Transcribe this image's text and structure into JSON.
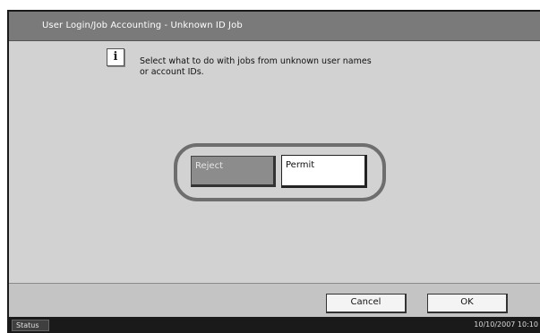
{
  "header": {
    "title": "User Login/Job Accounting - Unknown ID Job"
  },
  "message": {
    "icon": "info-icon",
    "text": "Select what to do with jobs from unknown user names\nor account IDs."
  },
  "options": {
    "reject_label": "Reject",
    "permit_label": "Permit",
    "selected": "Reject"
  },
  "footer": {
    "cancel_label": "Cancel",
    "ok_label": "OK"
  },
  "statusbar": {
    "status_label": "Status",
    "datetime": "10/10/2007   10:10"
  },
  "colors": {
    "titlebar": "#7a7a7a",
    "panel": "#d2d2d2",
    "selected_button": "#8c8c8c",
    "statusbar": "#1a1a1a"
  }
}
